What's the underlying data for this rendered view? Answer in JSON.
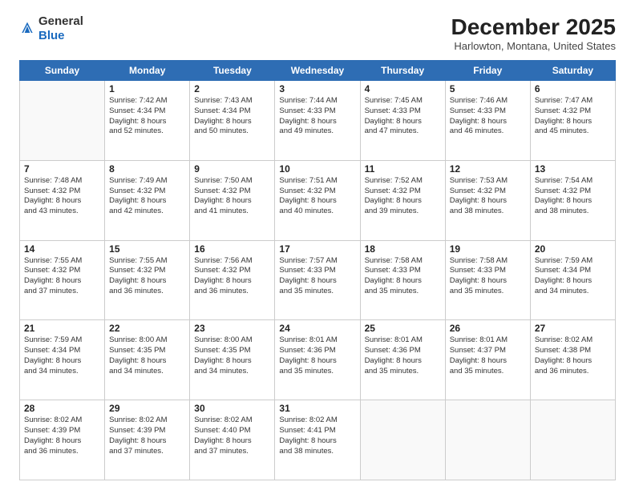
{
  "header": {
    "logo_general": "General",
    "logo_blue": "Blue",
    "month_title": "December 2025",
    "location": "Harlowton, Montana, United States"
  },
  "weekdays": [
    "Sunday",
    "Monday",
    "Tuesday",
    "Wednesday",
    "Thursday",
    "Friday",
    "Saturday"
  ],
  "weeks": [
    [
      {
        "day": "",
        "text": ""
      },
      {
        "day": "1",
        "text": "Sunrise: 7:42 AM\nSunset: 4:34 PM\nDaylight: 8 hours\nand 52 minutes."
      },
      {
        "day": "2",
        "text": "Sunrise: 7:43 AM\nSunset: 4:34 PM\nDaylight: 8 hours\nand 50 minutes."
      },
      {
        "day": "3",
        "text": "Sunrise: 7:44 AM\nSunset: 4:33 PM\nDaylight: 8 hours\nand 49 minutes."
      },
      {
        "day": "4",
        "text": "Sunrise: 7:45 AM\nSunset: 4:33 PM\nDaylight: 8 hours\nand 47 minutes."
      },
      {
        "day": "5",
        "text": "Sunrise: 7:46 AM\nSunset: 4:33 PM\nDaylight: 8 hours\nand 46 minutes."
      },
      {
        "day": "6",
        "text": "Sunrise: 7:47 AM\nSunset: 4:32 PM\nDaylight: 8 hours\nand 45 minutes."
      }
    ],
    [
      {
        "day": "7",
        "text": "Sunrise: 7:48 AM\nSunset: 4:32 PM\nDaylight: 8 hours\nand 43 minutes."
      },
      {
        "day": "8",
        "text": "Sunrise: 7:49 AM\nSunset: 4:32 PM\nDaylight: 8 hours\nand 42 minutes."
      },
      {
        "day": "9",
        "text": "Sunrise: 7:50 AM\nSunset: 4:32 PM\nDaylight: 8 hours\nand 41 minutes."
      },
      {
        "day": "10",
        "text": "Sunrise: 7:51 AM\nSunset: 4:32 PM\nDaylight: 8 hours\nand 40 minutes."
      },
      {
        "day": "11",
        "text": "Sunrise: 7:52 AM\nSunset: 4:32 PM\nDaylight: 8 hours\nand 39 minutes."
      },
      {
        "day": "12",
        "text": "Sunrise: 7:53 AM\nSunset: 4:32 PM\nDaylight: 8 hours\nand 38 minutes."
      },
      {
        "day": "13",
        "text": "Sunrise: 7:54 AM\nSunset: 4:32 PM\nDaylight: 8 hours\nand 38 minutes."
      }
    ],
    [
      {
        "day": "14",
        "text": "Sunrise: 7:55 AM\nSunset: 4:32 PM\nDaylight: 8 hours\nand 37 minutes."
      },
      {
        "day": "15",
        "text": "Sunrise: 7:55 AM\nSunset: 4:32 PM\nDaylight: 8 hours\nand 36 minutes."
      },
      {
        "day": "16",
        "text": "Sunrise: 7:56 AM\nSunset: 4:32 PM\nDaylight: 8 hours\nand 36 minutes."
      },
      {
        "day": "17",
        "text": "Sunrise: 7:57 AM\nSunset: 4:33 PM\nDaylight: 8 hours\nand 35 minutes."
      },
      {
        "day": "18",
        "text": "Sunrise: 7:58 AM\nSunset: 4:33 PM\nDaylight: 8 hours\nand 35 minutes."
      },
      {
        "day": "19",
        "text": "Sunrise: 7:58 AM\nSunset: 4:33 PM\nDaylight: 8 hours\nand 35 minutes."
      },
      {
        "day": "20",
        "text": "Sunrise: 7:59 AM\nSunset: 4:34 PM\nDaylight: 8 hours\nand 34 minutes."
      }
    ],
    [
      {
        "day": "21",
        "text": "Sunrise: 7:59 AM\nSunset: 4:34 PM\nDaylight: 8 hours\nand 34 minutes."
      },
      {
        "day": "22",
        "text": "Sunrise: 8:00 AM\nSunset: 4:35 PM\nDaylight: 8 hours\nand 34 minutes."
      },
      {
        "day": "23",
        "text": "Sunrise: 8:00 AM\nSunset: 4:35 PM\nDaylight: 8 hours\nand 34 minutes."
      },
      {
        "day": "24",
        "text": "Sunrise: 8:01 AM\nSunset: 4:36 PM\nDaylight: 8 hours\nand 35 minutes."
      },
      {
        "day": "25",
        "text": "Sunrise: 8:01 AM\nSunset: 4:36 PM\nDaylight: 8 hours\nand 35 minutes."
      },
      {
        "day": "26",
        "text": "Sunrise: 8:01 AM\nSunset: 4:37 PM\nDaylight: 8 hours\nand 35 minutes."
      },
      {
        "day": "27",
        "text": "Sunrise: 8:02 AM\nSunset: 4:38 PM\nDaylight: 8 hours\nand 36 minutes."
      }
    ],
    [
      {
        "day": "28",
        "text": "Sunrise: 8:02 AM\nSunset: 4:39 PM\nDaylight: 8 hours\nand 36 minutes."
      },
      {
        "day": "29",
        "text": "Sunrise: 8:02 AM\nSunset: 4:39 PM\nDaylight: 8 hours\nand 37 minutes."
      },
      {
        "day": "30",
        "text": "Sunrise: 8:02 AM\nSunset: 4:40 PM\nDaylight: 8 hours\nand 37 minutes."
      },
      {
        "day": "31",
        "text": "Sunrise: 8:02 AM\nSunset: 4:41 PM\nDaylight: 8 hours\nand 38 minutes."
      },
      {
        "day": "",
        "text": ""
      },
      {
        "day": "",
        "text": ""
      },
      {
        "day": "",
        "text": ""
      }
    ]
  ]
}
